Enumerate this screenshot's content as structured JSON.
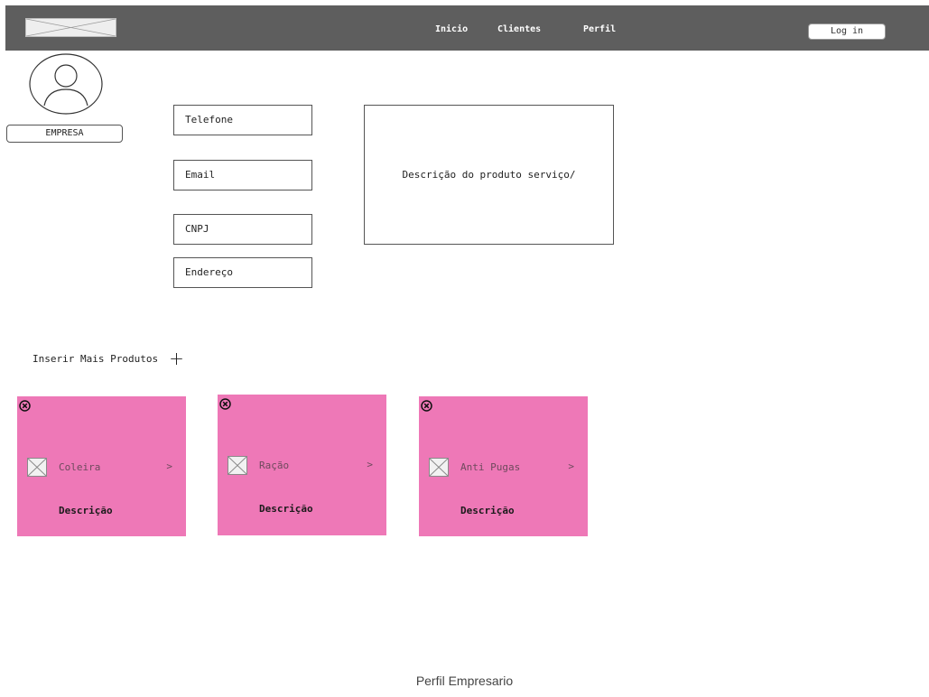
{
  "header": {
    "logo": "image-placeholder-icon",
    "nav": [
      "Inicio",
      "Clientes",
      "Perfil"
    ],
    "login_label": "Log in"
  },
  "profile": {
    "avatar_icon": "user-avatar-icon",
    "company_label": "EMPRESA"
  },
  "fields": {
    "phone": "Telefone",
    "email": "Email",
    "cnpj": "CNPJ",
    "address": "Endereço"
  },
  "description_placeholder": "Descrição do produto serviço/",
  "products": {
    "add_label": "Inserir Mais Produtos",
    "add_icon": "plus-icon",
    "items": [
      {
        "name": "Coleira",
        "desc": "Descrição"
      },
      {
        "name": "Ração",
        "desc": "Descrição"
      },
      {
        "name": "Anti Pugas",
        "desc": "Descrição"
      }
    ],
    "card_color": "#ee78b7",
    "chevron": ">"
  },
  "caption": "Perfil Empresario",
  "colors": {
    "topbar": "#5e5e5e",
    "background": "#ffffff"
  }
}
